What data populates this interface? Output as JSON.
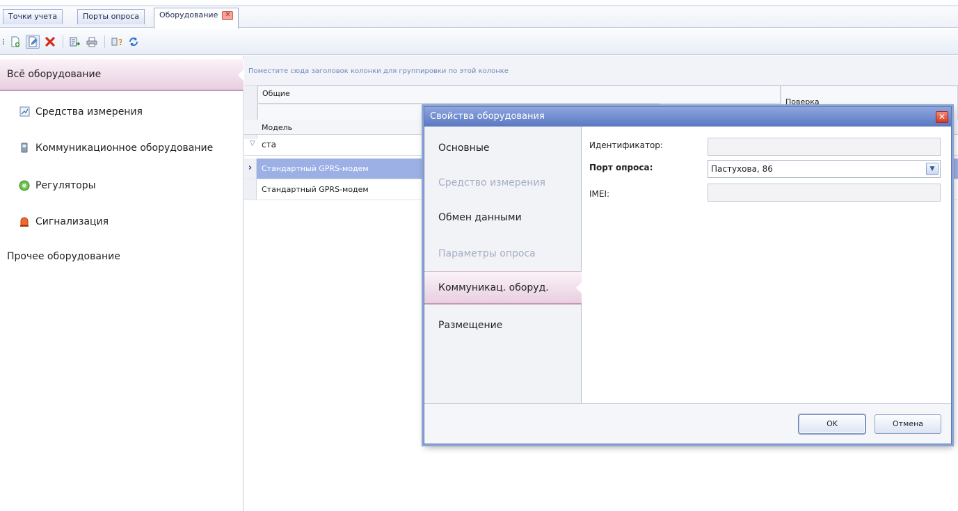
{
  "tabs": [
    {
      "label": "Точки учета"
    },
    {
      "label": "Порты опроса"
    },
    {
      "label": "Оборудование",
      "active": true,
      "close_icon": "close-icon"
    }
  ],
  "toolbar": {
    "icons": [
      "new-document-icon",
      "edit-icon",
      "delete-icon",
      "export-icon",
      "print-icon",
      "help-icon",
      "refresh-icon"
    ]
  },
  "sidebar": {
    "items": [
      {
        "label": "Всё оборудование",
        "selected": true
      },
      {
        "label": "Средства измерения",
        "icon": "measuring-device-icon"
      },
      {
        "label": "Коммуникационное оборудование",
        "icon": "communication-device-icon"
      },
      {
        "label": "Регуляторы",
        "icon": "regulator-icon"
      },
      {
        "label": "Сигнализация",
        "icon": "alarm-icon"
      },
      {
        "label": "Прочее оборудование"
      }
    ]
  },
  "grid": {
    "group_panel_hint": "Поместите сюда заголовок колонки для группировки по этой колонке",
    "bands": {
      "general": "Общие",
      "verification": "Поверка"
    },
    "columns": {
      "model": "Модель"
    },
    "filter_value": "ста",
    "rows": [
      {
        "model": "Стандартный GPRS-модем",
        "selected": true
      },
      {
        "model": "Стандартный GPRS-модем",
        "selected": false
      }
    ]
  },
  "dialog": {
    "title": "Свойства оборудования",
    "nav": [
      {
        "label": "Основные",
        "enabled": true
      },
      {
        "label": "Средство измерения",
        "enabled": false
      },
      {
        "label": "Обмен данными",
        "enabled": true
      },
      {
        "label": "Параметры опроса",
        "enabled": false
      },
      {
        "label": "Коммуникац. оборуд.",
        "enabled": true,
        "selected": true
      },
      {
        "label": "Размещение",
        "enabled": true
      }
    ],
    "fields": {
      "identifier": {
        "label": "Идентификатор:",
        "value": ""
      },
      "port": {
        "label": "Порт опроса:",
        "value": "Пастухова, 86"
      },
      "imei": {
        "label": "IMEI:",
        "value": ""
      }
    },
    "buttons": {
      "ok": "OK",
      "cancel": "Отмена"
    }
  }
}
